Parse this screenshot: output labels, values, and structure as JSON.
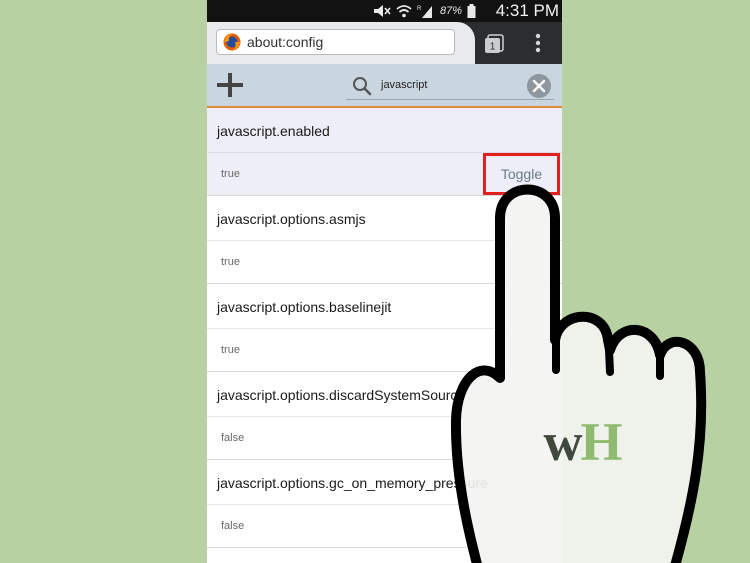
{
  "status_bar": {
    "battery_percent": "87%",
    "time": "4:31 PM"
  },
  "browser": {
    "url": "about:config",
    "tab_count": "1"
  },
  "toolbar": {
    "search_query": "javascript"
  },
  "preferences": [
    {
      "name": "javascript.enabled",
      "value": "true",
      "selected": true,
      "action": "Toggle"
    },
    {
      "name": "javascript.options.asmjs",
      "value": "true"
    },
    {
      "name": "javascript.options.baselinejit",
      "value": "true"
    },
    {
      "name": "javascript.options.discardSystemSource",
      "value": "false"
    },
    {
      "name": "javascript.options.gc_on_memory_pressure",
      "value": "false"
    }
  ],
  "overlay": {
    "logo_text": "wH",
    "icon": "pointing-hand-icon"
  },
  "colors": {
    "background": "#b8d1a2",
    "highlight": "#e32020",
    "accent_underline": "#e08a3a",
    "logo_dark": "#3f4a3c",
    "logo_light": "#8fba6f"
  }
}
